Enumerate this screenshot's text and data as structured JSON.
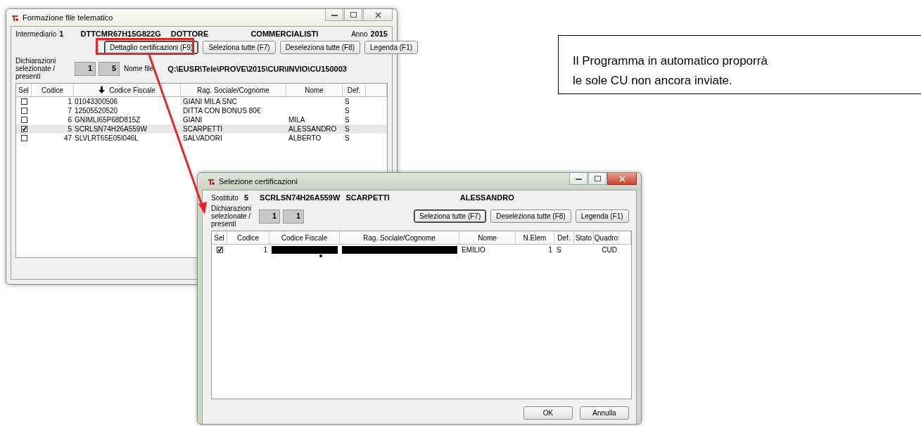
{
  "main_window": {
    "title": "Formazione file telematico",
    "intermediary": {
      "label": "Intermediario",
      "number": "1",
      "tax_code": "DTTCMR67H15G822G",
      "surname": "DOTTORE",
      "name": "COMMERCIALISTI",
      "year_label": "Anno",
      "year": "2015"
    },
    "buttons": [
      {
        "label": "Dettaglio certificazioni (F9)",
        "focused": true
      },
      {
        "label": "Seleziona tutte (F7)",
        "focused": false
      },
      {
        "label": "Deseleziona tutte (F8)",
        "focused": false
      },
      {
        "label": "Legenda (F1)",
        "focused": false
      }
    ],
    "counter_label": "Dichiarazioni selezionate / presenti",
    "selected_count": "1",
    "present_count": "5",
    "file_label": "Nome file",
    "file_path": "Q:\\EUSR\\Tele\\PROVE\\2015\\CUR\\INVIO\\CU150003",
    "columns": [
      "Sel",
      "Codice",
      "Codice Fiscale",
      "Rag. Sociale/Cognome",
      "Nome",
      "Def."
    ],
    "rows": [
      {
        "checked": false,
        "selected": false,
        "codice": "1",
        "codice_fiscale": "01043300506",
        "rag_sociale": "GIANI MILA SNC",
        "nome": "",
        "def": "S"
      },
      {
        "checked": false,
        "selected": false,
        "codice": "7",
        "codice_fiscale": "12505520520",
        "rag_sociale": "DITTA CON BONUS 80€",
        "nome": "",
        "def": "S"
      },
      {
        "checked": false,
        "selected": false,
        "codice": "6",
        "codice_fiscale": "GNIMLI65P68D815Z",
        "rag_sociale": "GIANI",
        "nome": "MILA",
        "def": "S"
      },
      {
        "checked": true,
        "selected": true,
        "codice": "5",
        "codice_fiscale": "SCRLSN74H26A559W",
        "rag_sociale": "SCARPETTI",
        "nome": "ALESSANDRO",
        "def": "S"
      },
      {
        "checked": false,
        "selected": false,
        "codice": "47",
        "codice_fiscale": "SLVLRT65E05I046L",
        "rag_sociale": "SALVADORI",
        "nome": "ALBERTO",
        "def": "S"
      }
    ]
  },
  "detail_window": {
    "title": "Selezione certificazioni",
    "substitute": {
      "label": "Sostituto",
      "number": "5",
      "tax_code": "SCRLSN74H26A559W",
      "surname": "SCARPETTI",
      "name": "ALESSANDRO"
    },
    "counter_label": "Dichiarazioni selezionate / presenti",
    "selected_count": "1",
    "present_count": "1",
    "buttons": [
      {
        "label": "Seleziona tutte (F7)",
        "focused": true
      },
      {
        "label": "Deseleziona tutte (F8)",
        "focused": false
      },
      {
        "label": "Legenda (F1)",
        "focused": false
      }
    ],
    "columns": [
      "Sel",
      "Codice",
      "Codice Fiscale",
      "Rag. Sociale/Cognome",
      "Nome",
      "N.Elem",
      "Def.",
      "Stato",
      "Quadro"
    ],
    "rows": [
      {
        "checked": true,
        "selected": false,
        "codice": "1",
        "codice_fiscale_redacted": true,
        "rag_sociale_redacted": true,
        "nome": "EMILIO",
        "n_elem": "1",
        "def": "S",
        "stato": "",
        "quadro": "CUD"
      }
    ],
    "footer_buttons": [
      "OK",
      "Annulla"
    ]
  },
  "callout": {
    "lines": [
      "Il Programma in automatico proporrà",
      "le sole CU non ancora inviate."
    ]
  }
}
